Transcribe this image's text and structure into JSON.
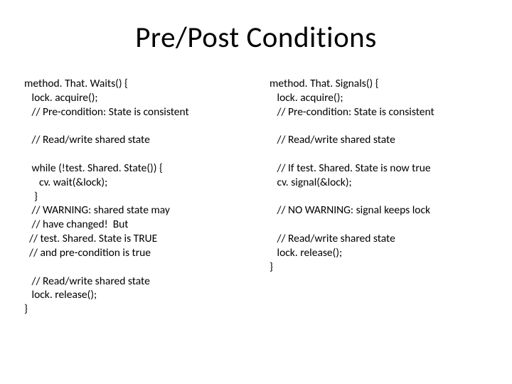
{
  "title": "Pre/Post Conditions",
  "left": {
    "l01": "method. That. Waits() {",
    "l02": "   lock. acquire();",
    "l03": "   // Pre-condition: State is consistent",
    "l04": "",
    "l05": "   // Read/write shared state",
    "l06": "",
    "l07": "   while (!test. Shared. State()) {",
    "l08": "      cv. wait(&lock);",
    "l09": "    }",
    "l10": "   // WARNING: shared state may",
    "l11": "   // have changed!  But",
    "l12": "  // test. Shared. State is TRUE",
    "l13": "  // and pre-condition is true",
    "l14": "",
    "l15": "   // Read/write shared state",
    "l16": "   lock. release();",
    "l17": "}"
  },
  "right": {
    "r01": "method. That. Signals() {",
    "r02": "   lock. acquire();",
    "r03": "   // Pre-condition: State is consistent",
    "r04": "",
    "r05": "   // Read/write shared state",
    "r06": "",
    "r07": "   // If test. Shared. State is now true",
    "r08": "   cv. signal(&lock);",
    "r09": "",
    "r10": "   // NO WARNING: signal keeps lock",
    "r11": "",
    "r12": "   // Read/write shared state",
    "r13": "   lock. release();",
    "r14": "}"
  }
}
